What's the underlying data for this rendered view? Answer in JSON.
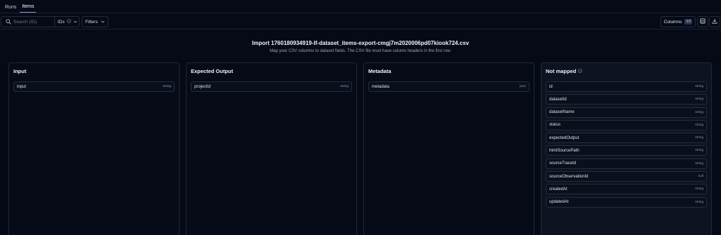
{
  "tabs": [
    {
      "label": "Runs"
    },
    {
      "label": "Items"
    }
  ],
  "toolbar": {
    "search_placeholder": "Search (ID)",
    "search_mode": "IDs",
    "filters_label": "Filters",
    "columns_label": "Columns",
    "columns_count": "9/9"
  },
  "import": {
    "title": "Import 1760180934919-lf-dataset_items-export-cmgj7m2020006pd07kiook724.csv",
    "subtitle": "Map your CSV columns to dataset fields. The CSV file must have column headers in the first row."
  },
  "panels": [
    {
      "title": "Input",
      "rows": [
        {
          "name": "input",
          "type": "string"
        }
      ]
    },
    {
      "title": "Expected Output",
      "rows": [
        {
          "name": "projectId",
          "type": "string"
        }
      ]
    },
    {
      "title": "Metadata",
      "rows": [
        {
          "name": "metadata",
          "type": "json"
        }
      ]
    },
    {
      "title": "Not mapped",
      "rows": [
        {
          "name": "id",
          "type": "string"
        },
        {
          "name": "datasetId",
          "type": "string"
        },
        {
          "name": "datasetName",
          "type": "string"
        },
        {
          "name": "status",
          "type": "string"
        },
        {
          "name": "expectedOutput",
          "type": "string"
        },
        {
          "name": "htmlSourcePath",
          "type": "string"
        },
        {
          "name": "sourceTraceId",
          "type": "string"
        },
        {
          "name": "sourceObservationId",
          "type": "null"
        },
        {
          "name": "createdAt",
          "type": "string"
        },
        {
          "name": "updatedAt",
          "type": "string"
        }
      ]
    }
  ],
  "colors": {
    "background": "#060a16",
    "accent": "#8b8ff7",
    "border": "#1f2638"
  },
  "icons": [
    "search-icon",
    "info-icon",
    "chevron-down-icon",
    "layout-icon",
    "download-icon"
  ]
}
